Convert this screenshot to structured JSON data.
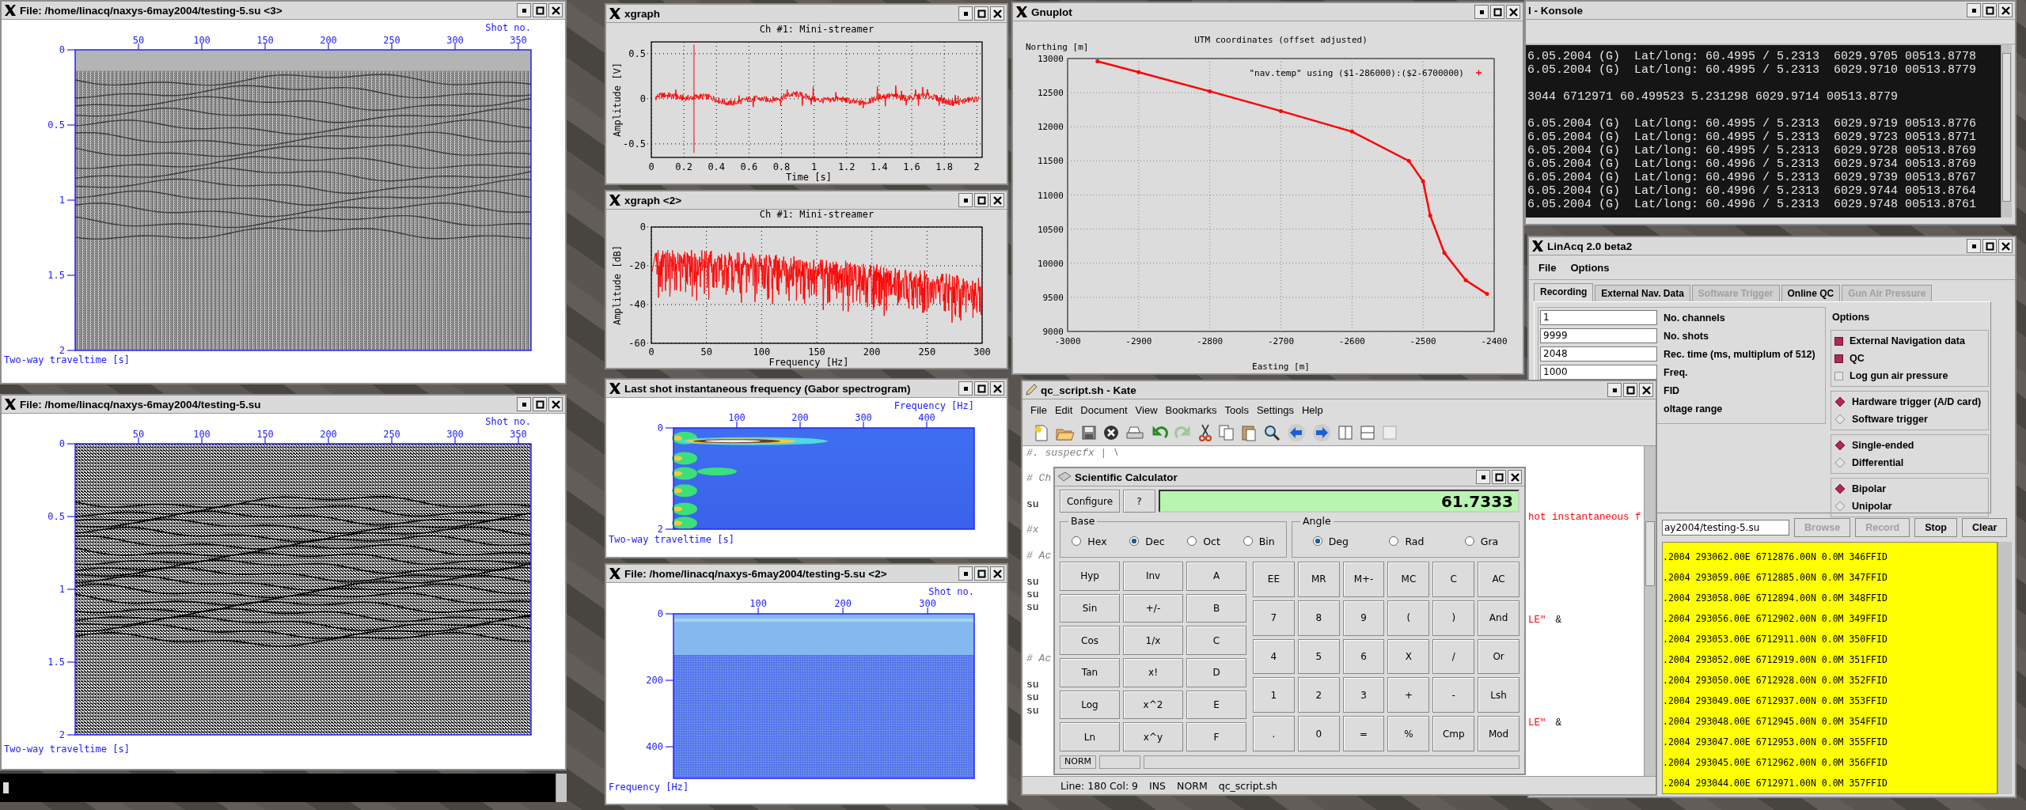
{
  "seismic_window_3": {
    "title": "File: /home/linacq/naxys-6may2004/testing-5.su <3>",
    "x_axis_title": "Shot no.",
    "x_ticks": [
      "50",
      "100",
      "150",
      "200",
      "250",
      "300",
      "350"
    ],
    "y_ticks": [
      "0",
      "0.5",
      "1",
      "1.5",
      "2"
    ],
    "y_axis_title": "Two-way traveltime [s]"
  },
  "seismic_window": {
    "title": "File: /home/linacq/naxys-6may2004/testing-5.su",
    "x_axis_title": "Shot no.",
    "x_ticks": [
      "50",
      "100",
      "150",
      "200",
      "250",
      "300",
      "350"
    ],
    "y_ticks": [
      "0",
      "0.5",
      "1",
      "1.5",
      "2"
    ],
    "y_axis_title": "Two-way traveltime [s]"
  },
  "xgraph_window": {
    "title": "xgraph",
    "plot_title": "Ch #1: Mini-streamer",
    "x_ticks": [
      "0",
      "0.2",
      "0.4",
      "0.6",
      "0.8",
      "1",
      "1.2",
      "1.4",
      "1.6",
      "1.8",
      "2"
    ],
    "y_ticks": [
      "0.5",
      "0",
      "-0.5"
    ],
    "x_axis_title": "Time [s]",
    "y_axis_title": "Amplitude [V]"
  },
  "xgraph_window_2": {
    "title": "xgraph <2>",
    "plot_title": "Ch #1: Mini-streamer",
    "x_ticks": [
      "0",
      "50",
      "100",
      "150",
      "200",
      "250",
      "300"
    ],
    "y_ticks": [
      "0",
      "-20",
      "-40",
      "-60"
    ],
    "x_axis_title": "Frequency [Hz]",
    "y_axis_title": "Amplitude [dB]"
  },
  "spectrogram_window": {
    "title": "Last shot instantaneous frequency (Gabor spectrogram)",
    "x_axis_title": "Frequency [Hz]",
    "x_ticks": [
      "100",
      "200",
      "300",
      "400"
    ],
    "y_ticks": [
      "0",
      "2"
    ],
    "y_axis_title": "Two-way traveltime [s]"
  },
  "frequency_window": {
    "title": "File: /home/linacq/naxys-6may2004/testing-5.su <2>",
    "x_axis_title": "Shot no.",
    "x_ticks": [
      "100",
      "200",
      "300"
    ],
    "y_ticks": [
      "0",
      "200",
      "400"
    ],
    "y_axis_title": "Frequency [Hz]"
  },
  "gnuplot_window": {
    "title": "Gnuplot",
    "chart_data": {
      "type": "line",
      "title": "UTM coordinates (offset adjusted)",
      "xlabel": "Easting [m]",
      "ylabel": "Northing [m]",
      "x": [
        -2958,
        -2900,
        -2800,
        -2700,
        -2600,
        -2520,
        -2500,
        -2490,
        -2470,
        -2440,
        -2410
      ],
      "series": [
        {
          "name": "\"nav.temp\" using ($1-286000):($2-6700000)",
          "color": "#ff0000",
          "values": [
            12960,
            12800,
            12520,
            12230,
            11930,
            11500,
            11200,
            10700,
            10150,
            9750,
            9550
          ]
        }
      ],
      "grid": true,
      "xlim": [
        -3000,
        -2400
      ],
      "ylim": [
        9000,
        13000
      ],
      "xticks": [
        -3000,
        -2900,
        -2800,
        -2700,
        -2600,
        -2500,
        -2400
      ],
      "yticks": [
        9000,
        9500,
        10000,
        10500,
        11000,
        11500,
        12000,
        12500,
        13000
      ]
    }
  },
  "konsole_window": {
    "title": "l - Konsole",
    "blocks": [
      [
        "6.05.2004 (G)  Lat/long: 60.4995 / 5.2313  6029.9705 00513.8778",
        "6.05.2004 (G)  Lat/long: 60.4995 / 5.2313  6029.9710 00513.8779"
      ],
      [
        "3044 6712971 60.499523 5.231298 6029.9714 00513.8779"
      ],
      [
        "6.05.2004 (G)  Lat/long: 60.4995 / 5.2313  6029.9719 00513.8776",
        "6.05.2004 (G)  Lat/long: 60.4995 / 5.2313  6029.9723 00513.8771",
        "6.05.2004 (G)  Lat/long: 60.4995 / 5.2313  6029.9728 00513.8769",
        "6.05.2004 (G)  Lat/long: 60.4996 / 5.2313  6029.9734 00513.8769",
        "6.05.2004 (G)  Lat/long: 60.4996 / 5.2313  6029.9739 00513.8767",
        "6.05.2004 (G)  Lat/long: 60.4996 / 5.2313  6029.9744 00513.8764",
        "6.05.2004 (G)  Lat/long: 60.4996 / 5.2313  6029.9748 00513.8761"
      ]
    ]
  },
  "linacq_window": {
    "title": "LinAcq 2.0 beta2",
    "menu": [
      "File",
      "Options"
    ],
    "tabs": [
      {
        "label": "Recording",
        "selected": true,
        "disabled": false
      },
      {
        "label": "External Nav. Data",
        "selected": false,
        "disabled": false
      },
      {
        "label": "Software Trigger",
        "selected": false,
        "disabled": true
      },
      {
        "label": "Online QC",
        "selected": false,
        "disabled": false
      },
      {
        "label": "Gun Air Pressure",
        "selected": false,
        "disabled": true
      }
    ],
    "fields": [
      {
        "value": "1",
        "label": "No. channels"
      },
      {
        "value": "9999",
        "label": "No. shots"
      },
      {
        "value": "2048",
        "label": "Rec. time (ms, multiplum of 512)"
      },
      {
        "value": "1000",
        "label": "Freq."
      },
      {
        "label": "FID"
      },
      {
        "label": "oltage range"
      }
    ],
    "options_title": "Options",
    "checkboxes": [
      {
        "label": "External Navigation data",
        "checked": true
      },
      {
        "label": "QC",
        "checked": true
      },
      {
        "label": "Log gun air pressure",
        "checked": false
      }
    ],
    "radio_groups": [
      [
        {
          "label": "Hardware trigger (A/D card)",
          "selected": true
        },
        {
          "label": "Software trigger",
          "selected": false
        }
      ],
      [
        {
          "label": "Single-ended",
          "selected": true
        },
        {
          "label": "Differential",
          "selected": false
        }
      ],
      [
        {
          "label": "Bipolar",
          "selected": true
        },
        {
          "label": "Unipolar",
          "selected": false
        }
      ]
    ],
    "file_field": {
      "value": "ay2004/testing-5.su"
    },
    "buttons": [
      {
        "label": "Browse",
        "disabled": true
      },
      {
        "label": "Record",
        "disabled": true
      },
      {
        "label": "Stop",
        "disabled": false
      },
      {
        "label": "Clear",
        "disabled": false
      }
    ],
    "log_lines": [
      ".2004 293062.00E 6712876.00N 0.0M 346FFID",
      ".2004 293059.00E 6712885.00N 0.0M 347FFID",
      ".2004 293058.00E 6712894.00N 0.0M 348FFID",
      ".2004 293056.00E 6712902.00N 0.0M 349FFID",
      ".2004 293053.00E 6712911.00N 0.0M 350FFID",
      ".2004 293052.00E 6712919.00N 0.0M 351FFID",
      ".2004 293050.00E 6712928.00N 0.0M 352FFID",
      ".2004 293049.00E 6712937.00N 0.0M 353FFID",
      ".2004 293048.00E 6712945.00N 0.0M 354FFID",
      ".2004 293047.00E 6712953.00N 0.0M 355FFID",
      ".2004 293045.00E 6712962.00N 0.0M 356FFID",
      ".2004 293044.00E 6712971.00N 0.0M 357FFID"
    ]
  },
  "kate_window": {
    "title": "qc_script.sh - Kate",
    "menu": [
      "File",
      "Edit",
      "Document",
      "View",
      "Bookmarks",
      "Tools",
      "Settings",
      "Help"
    ],
    "lines": [
      {
        "kind": "comment",
        "text": "#. suspecfx | \\"
      },
      {
        "kind": "blank"
      },
      {
        "kind": "comment",
        "text": "# Ch"
      },
      {
        "kind": "blank"
      },
      {
        "kind": "code",
        "text": "su"
      },
      {
        "kind": "string",
        "right": "hot instantaneous f"
      },
      {
        "kind": "comment",
        "text": "#x"
      },
      {
        "kind": "blank"
      },
      {
        "kind": "comment",
        "text": "# Ac"
      },
      {
        "kind": "blank"
      },
      {
        "kind": "code",
        "text": "su"
      },
      {
        "kind": "code",
        "text": "su"
      },
      {
        "kind": "code",
        "text": "su"
      },
      {
        "kind": "string",
        "right": "LE\"",
        "tail": "&"
      },
      {
        "kind": "blank"
      },
      {
        "kind": "blank"
      },
      {
        "kind": "comment",
        "text": "# Ac"
      },
      {
        "kind": "blank"
      },
      {
        "kind": "code",
        "text": "su"
      },
      {
        "kind": "code",
        "text": "su"
      },
      {
        "kind": "code",
        "text": "su"
      },
      {
        "kind": "string",
        "right": "LE\"",
        "tail": "&"
      }
    ],
    "status": [
      "Line: 180 Col: 9",
      "INS",
      "NORM",
      "qc_script.sh"
    ]
  },
  "calculator_window": {
    "title": "Scientific Calculator",
    "configure": "Configure",
    "help": "?",
    "display": "61.7333",
    "base_title": "Base",
    "base": [
      {
        "label": "Hex",
        "selected": false
      },
      {
        "label": "Dec",
        "selected": true
      },
      {
        "label": "Oct",
        "selected": false
      },
      {
        "label": "Bin",
        "selected": false
      }
    ],
    "angle_title": "Angle",
    "angle": [
      {
        "label": "Deg",
        "selected": true
      },
      {
        "label": "Rad",
        "selected": false
      },
      {
        "label": "Gra",
        "selected": false
      }
    ],
    "function_keys": [
      "Hyp",
      "Inv",
      "A",
      "Sin",
      "+/-",
      "B",
      "Cos",
      "1/x",
      "C",
      "Tan",
      "x!",
      "D",
      "Log",
      "x^2",
      "E",
      "Ln",
      "x^y",
      "F"
    ],
    "number_keys": [
      "EE",
      "MR",
      "M+-",
      "MC",
      "C",
      "AC",
      "7",
      "8",
      "9",
      "(",
      ")",
      "And",
      "4",
      "5",
      "6",
      "X",
      "/",
      "Or",
      "1",
      "2",
      "3",
      "+",
      "-",
      "Lsh",
      ".",
      "0",
      "=",
      "%",
      "Cmp",
      "Mod"
    ],
    "status": "NORM"
  }
}
